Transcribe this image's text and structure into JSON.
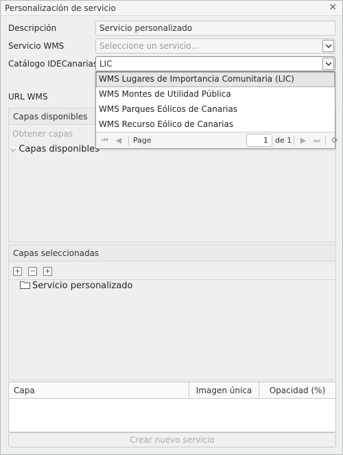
{
  "window": {
    "title": "Personalización de servicio"
  },
  "form": {
    "descripcion_label": "Descripción",
    "descripcion_value": "Servicio personalizado",
    "servicio_label": "Servicio WMS",
    "servicio_placeholder": "Seleccione un servicio...",
    "catalogo_label": "Catálogo IDECanarias",
    "catalogo_value": "LIC",
    "url_label": "URL WMS"
  },
  "dropdown": {
    "items": [
      "WMS Lugares de Importancia Comunitaria (LIC)",
      "WMS Montes de Utilidad Pública",
      "WMS Parques Eólicos de Canarias",
      "WMS Recurso Eólico de Canarias"
    ],
    "pager": {
      "page_label": "Page",
      "page_value": "1",
      "of_label": "de 1"
    }
  },
  "capas_disponibles": {
    "header": "Capas disponibles",
    "obtener_button": "Obtener capas",
    "tree_root": "Capas disponibles"
  },
  "capas_seleccionadas": {
    "header": "Capas seleccionadas",
    "tree_root": "Servicio personalizado",
    "icons": [
      "expand-all-icon",
      "collapse-all-icon",
      "new-folder-icon"
    ]
  },
  "grid": {
    "columns": [
      "Capa",
      "Imagen única",
      "Opacidad (%)"
    ]
  },
  "footer": {
    "create_button": "Crear nuevo servicio"
  },
  "colors": {
    "background": "#eef0f0",
    "hover": "#e6e6e6",
    "disabled_text": "#aaaaaa"
  }
}
